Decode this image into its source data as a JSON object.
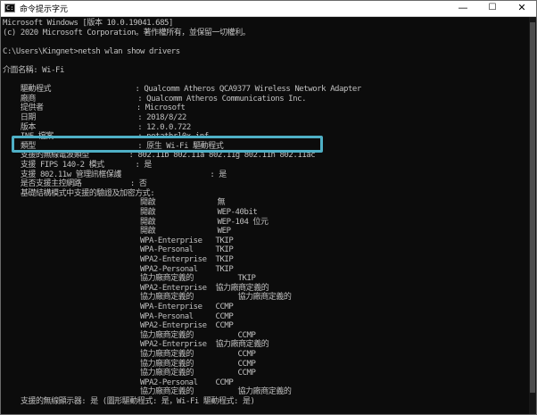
{
  "window": {
    "title": "命令提示字元",
    "controls": {
      "minimize": "—",
      "maximize": "☐",
      "close": "✕"
    }
  },
  "console": {
    "lines": [
      "Microsoft Windows [版本 10.0.19041.685]",
      "(c) 2020 Microsoft Corporation。著作權所有，並保留一切權利。",
      "",
      "C:\\Users\\Kingnet>netsh wlan show drivers",
      "",
      "介面名稱: Wi-Fi",
      "",
      "    驅動程式                   : Qualcomm Atheros QCA9377 Wireless Network Adapter",
      "    廠商                       : Qualcomm Atheros Communications Inc.",
      "    提供者                     : Microsoft",
      "    日期                       : 2018/8/22",
      "    版本                       : 12.0.0.722",
      "    INF 檔案                   : netathrl0x.inf",
      "    類型                       : 原生 Wi-Fi 驅動程式",
      "    支援的無線電波類型         : 802.11b 802.11a 802.11g 802.11n 802.11ac",
      "    支援 FIPS 140-2 模式       : 是",
      "    支援 802.11w 管理訊框保護                    : 是",
      "    是否支援主控網路           : 否",
      "    基礎結構模式中支援的驗證及加密方式:",
      "                               開啟              無",
      "                               開啟              WEP-40bit",
      "                               開啟              WEP-104 位元",
      "                               開啟              WEP",
      "                               WPA-Enterprise   TKIP",
      "                               WPA-Personal     TKIP",
      "                               WPA2-Enterprise  TKIP",
      "                               WPA2-Personal    TKIP",
      "                               協力廠商定義的          TKIP",
      "                               WPA2-Enterprise  協力廠商定義的",
      "                               協力廠商定義的          協力廠商定義的",
      "                               WPA-Enterprise   CCMP",
      "                               WPA-Personal     CCMP",
      "                               WPA2-Enterprise  CCMP",
      "                               協力廠商定義的          CCMP",
      "                               WPA2-Enterprise  協力廠商定義的",
      "                               協力廠商定義的          CCMP",
      "                               協力廠商定義的          CCMP",
      "                               協力廠商定義的          CCMP",
      "                               WPA2-Personal    CCMP",
      "                               協力廠商定義的          協力廠商定義的",
      "    支援的無線顯示器: 是 (圖形驅動程式: 是，Wi-Fi 驅動程式: 是)",
      "",
      "C:\\Users\\Kingnet>"
    ]
  },
  "annotation": {
    "label": "highlight-supported-radio-types",
    "color": "#4fb0c6"
  }
}
